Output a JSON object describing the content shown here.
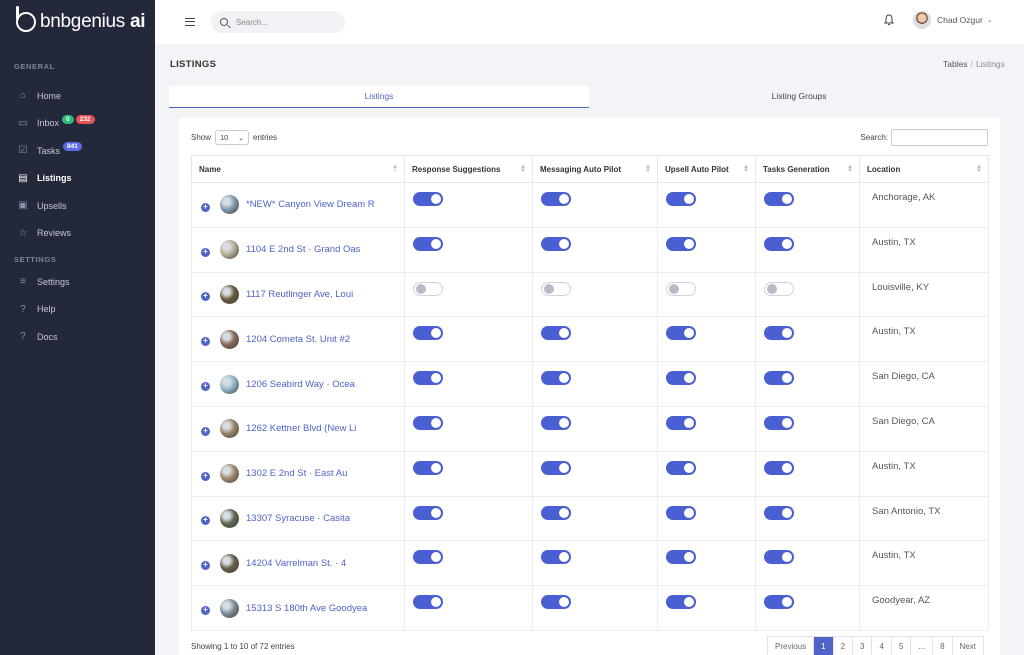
{
  "brand": {
    "name": "bnbgenius",
    "suffix": "ai"
  },
  "sidebar": {
    "sections": [
      {
        "label": "GENERAL"
      },
      {
        "label": "SETTINGS"
      }
    ],
    "items": [
      {
        "label": "Home",
        "icon": "home-icon"
      },
      {
        "label": "Inbox",
        "icon": "inbox-icon",
        "badges": [
          "0",
          "232"
        ]
      },
      {
        "label": "Tasks",
        "icon": "tasks-icon",
        "badges": [
          "841"
        ]
      },
      {
        "label": "Listings",
        "icon": "listings-icon",
        "active": true
      },
      {
        "label": "Upsells",
        "icon": "upsells-icon"
      },
      {
        "label": "Reviews",
        "icon": "star-icon"
      },
      {
        "label": "Settings",
        "icon": "sliders-icon"
      },
      {
        "label": "Help",
        "icon": "help-icon"
      },
      {
        "label": "Docs",
        "icon": "docs-icon"
      }
    ]
  },
  "topbar": {
    "search_placeholder": "Search...",
    "user_name": "Chad Ozgur"
  },
  "page": {
    "title": "LISTINGS",
    "breadcrumb": [
      "Tables",
      "Listings"
    ]
  },
  "tabs": [
    {
      "label": "Listings",
      "active": true
    },
    {
      "label": "Listing Groups",
      "active": false
    }
  ],
  "table_controls": {
    "show_label": "Show",
    "entries_value": "10",
    "entries_label": "entries",
    "search_label": "Search:"
  },
  "columns": [
    "Name",
    "Response Suggestions",
    "Messaging Auto Pilot",
    "Upsell Auto Pilot",
    "Tasks Generation",
    "Location"
  ],
  "rows": [
    {
      "name": "*NEW* Canyon View Dream R",
      "toggles": [
        true,
        true,
        true,
        true
      ],
      "location": "Anchorage, AK",
      "thumb": "#7f9bb0"
    },
    {
      "name": "1104 E 2nd St · Grand Oas",
      "toggles": [
        true,
        true,
        true,
        true
      ],
      "location": "Austin, TX",
      "thumb": "#b7ac98"
    },
    {
      "name": "1117 Reutlinger Ave, Loui",
      "toggles": [
        false,
        false,
        false,
        false
      ],
      "location": "Louisville, KY",
      "thumb": "#6b5a3a"
    },
    {
      "name": "1204 Cometa St. Unit #2",
      "toggles": [
        true,
        true,
        true,
        true
      ],
      "location": "Austin, TX",
      "thumb": "#8a6a5a"
    },
    {
      "name": "1206 Seabird Way · Ocea",
      "toggles": [
        true,
        true,
        true,
        true
      ],
      "location": "San Diego, CA",
      "thumb": "#8fb6c9"
    },
    {
      "name": "1262 Kettner Blvd (New Li",
      "toggles": [
        true,
        true,
        true,
        true
      ],
      "location": "San Diego, CA",
      "thumb": "#9a8468"
    },
    {
      "name": "1302 E 2nd St · East Au",
      "toggles": [
        true,
        true,
        true,
        true
      ],
      "location": "Austin, TX",
      "thumb": "#a08a70"
    },
    {
      "name": "13307 Syracuse · Casita",
      "toggles": [
        true,
        true,
        true,
        true
      ],
      "location": "San Antonio, TX",
      "thumb": "#5f6b52"
    },
    {
      "name": "14204 Varrelman St. · 4",
      "toggles": [
        true,
        true,
        true,
        true
      ],
      "location": "Austin, TX",
      "thumb": "#6a5e48"
    },
    {
      "name": "15313 S 180th Ave Goodyea",
      "toggles": [
        true,
        true,
        true,
        true
      ],
      "location": "Goodyear, AZ",
      "thumb": "#7c8e99"
    }
  ],
  "footer": {
    "info": "Showing 1 to 10 of 72 entries",
    "pager": [
      "Previous",
      "1",
      "2",
      "3",
      "4",
      "5",
      "...",
      "8",
      "Next"
    ],
    "active_page": "1"
  },
  "colors": {
    "accent": "#4f63c9",
    "sidebar_bg": "#23283b"
  }
}
